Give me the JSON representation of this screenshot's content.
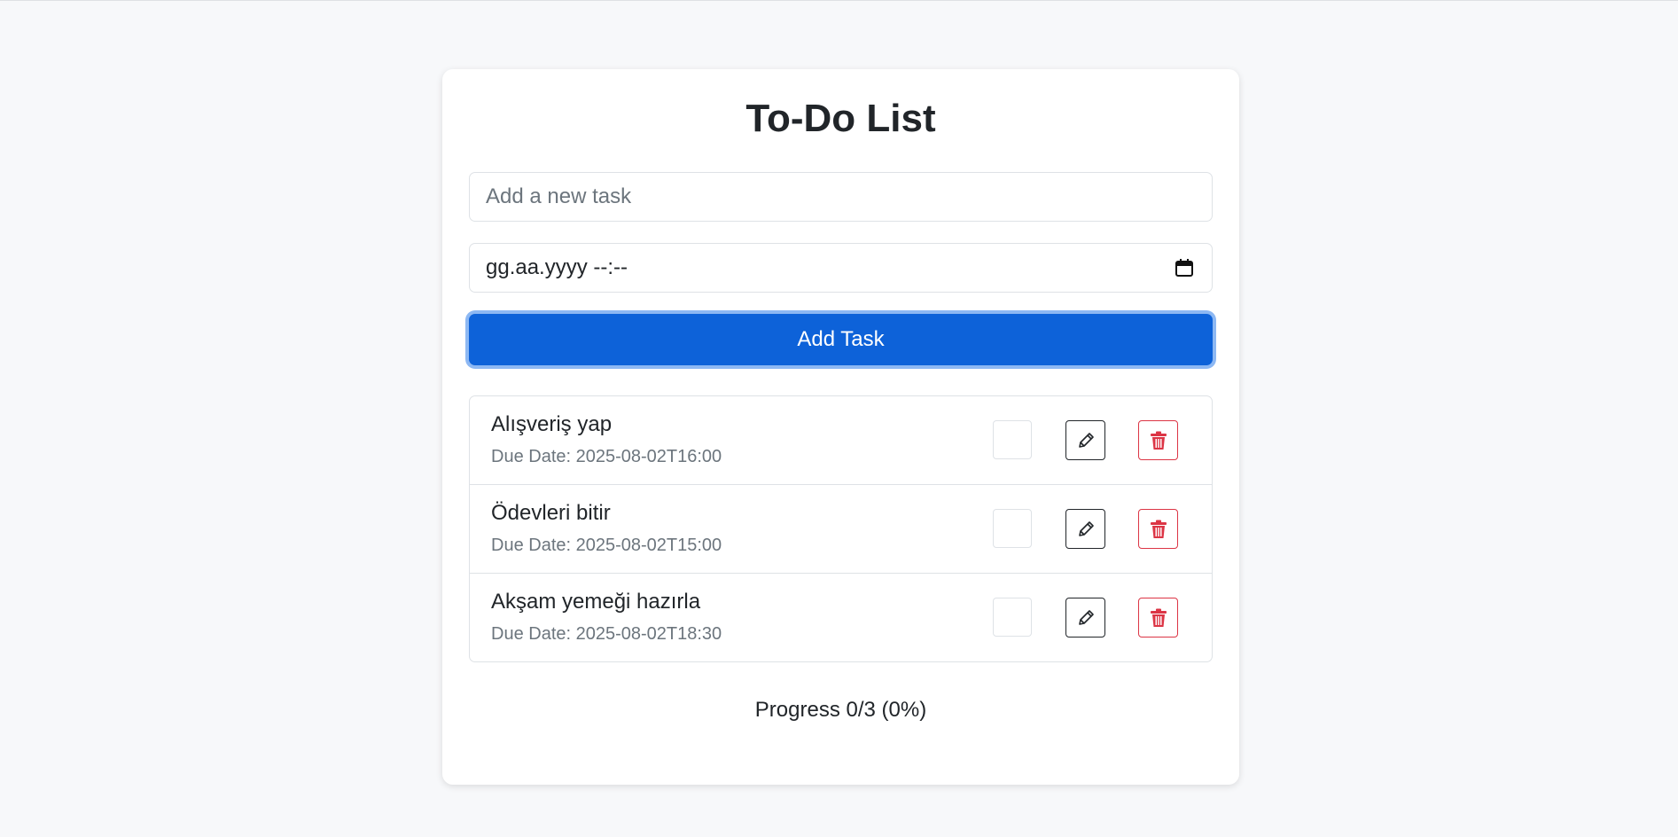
{
  "app": {
    "title": "To-Do List"
  },
  "form": {
    "task_placeholder": "Add a new task",
    "task_value": "",
    "date_placeholder": "gg.aa.yyyy --:--",
    "add_button_label": "Add Task"
  },
  "tasks": [
    {
      "name": "Alışveriş yap",
      "due": "Due Date: 2025-08-02T16:00",
      "completed": false
    },
    {
      "name": "Ödevleri bitir",
      "due": "Due Date: 2025-08-02T15:00",
      "completed": false
    },
    {
      "name": "Akşam yemeği hazırla",
      "due": "Due Date: 2025-08-02T18:30",
      "completed": false
    }
  ],
  "progress": {
    "text": "Progress 0/3 (0%)"
  },
  "icons": {
    "calendar": "calendar-icon",
    "edit": "pencil-icon",
    "delete": "trash-icon"
  },
  "colors": {
    "primary": "#0d62d9",
    "danger": "#dc3545",
    "muted": "#6c757d"
  }
}
